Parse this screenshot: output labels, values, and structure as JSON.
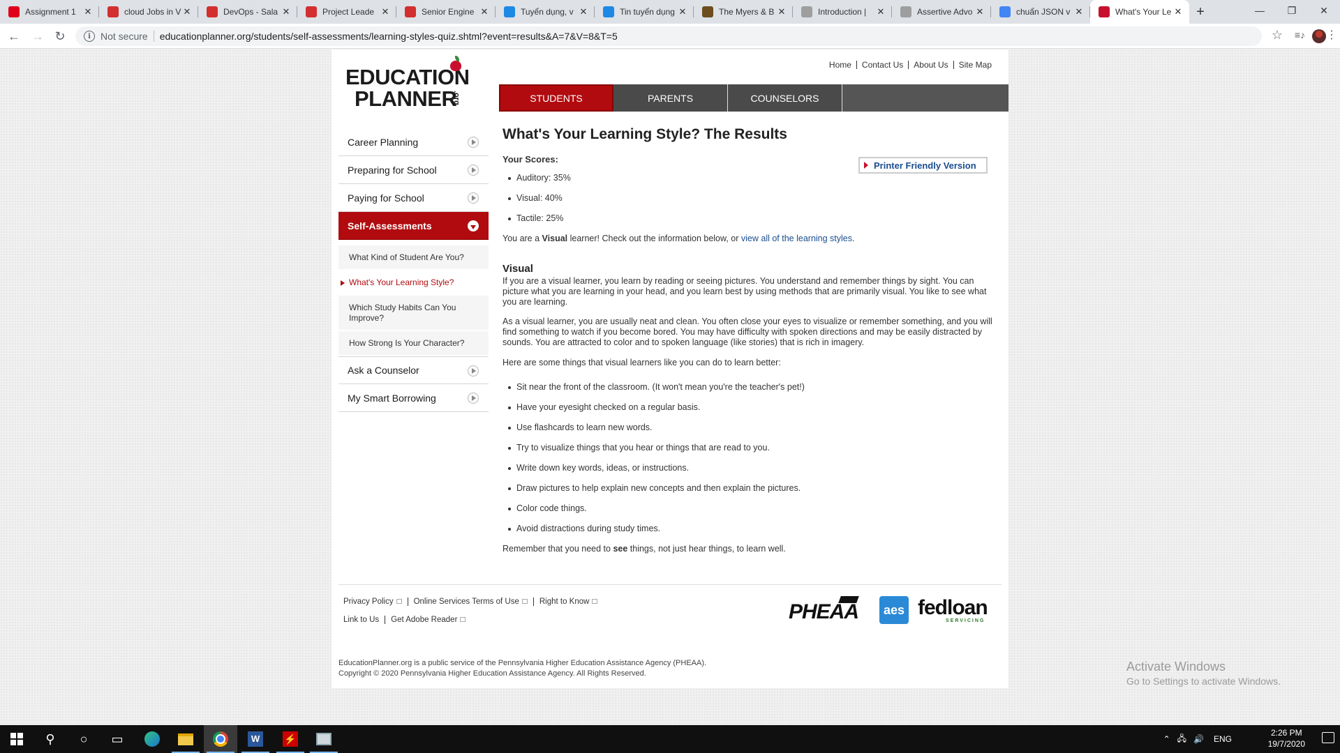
{
  "browser": {
    "tabs": [
      {
        "title": "Assignment 1",
        "favicon_color": "#e0001b"
      },
      {
        "title": "cloud Jobs in V",
        "favicon_color": "#d32f2f"
      },
      {
        "title": "DevOps - Sala",
        "favicon_color": "#d32f2f"
      },
      {
        "title": "Project Leade",
        "favicon_color": "#d32f2f"
      },
      {
        "title": "Senior Engine",
        "favicon_color": "#d32f2f"
      },
      {
        "title": "Tuyển dụng, v",
        "favicon_color": "#1e88e5"
      },
      {
        "title": "Tin tuyển dụng",
        "favicon_color": "#1e88e5"
      },
      {
        "title": "The Myers & B",
        "favicon_color": "#6d4c1f"
      },
      {
        "title": "Introduction |",
        "favicon_color": "#9e9e9e"
      },
      {
        "title": "Assertive Advo",
        "favicon_color": "#9e9e9e"
      },
      {
        "title": "chuẩn JSON v",
        "favicon_color": "#4285f4"
      },
      {
        "title": "What's Your Le",
        "favicon_color": "#c8102e"
      }
    ],
    "security_label": "Not secure",
    "url": "educationplanner.org/students/self-assessments/learning-styles-quiz.shtml?event=results&A=7&V=8&T=5"
  },
  "site": {
    "logo_line1": "EDUCATION",
    "logo_line2": "PLANNER",
    "logo_org": ".org",
    "top_links": [
      "Home",
      "Contact Us",
      "About Us",
      "Site Map"
    ],
    "main_nav": [
      "STUDENTS",
      "PARENTS",
      "COUNSELORS"
    ],
    "sidebar": {
      "items": [
        "Career Planning",
        "Preparing for School",
        "Paying for School",
        "Self-Assessments"
      ],
      "sub_items": [
        "What Kind of Student Are You?",
        "What's Your Learning Style?",
        "Which Study Habits Can You Improve?",
        "How Strong Is Your Character?"
      ],
      "items_after": [
        "Ask a Counselor",
        "My Smart Borrowing"
      ]
    }
  },
  "content": {
    "title": "What's Your Learning Style? The Results",
    "scores_label": "Your Scores:",
    "printer_label": "Printer Friendly Version",
    "scores": [
      "Auditory: 35%",
      "Visual: 40%",
      "Tactile: 25%"
    ],
    "you_are_prefix": "You are a ",
    "you_are_type": "Visual",
    "you_are_suffix": " learner! Check out the information below, or ",
    "you_are_link": "view all of the learning styles",
    "you_are_end": ".",
    "section_title": "Visual",
    "para1": "If you are a visual learner, you learn by reading or seeing pictures. You understand and remember things by sight. You can picture what you are learning in your head, and you learn best by using methods that are primarily visual. You like to see what you are learning.",
    "para2": "As a visual learner, you are usually neat and clean. You often close your eyes to visualize or remember something, and you will find something to watch if you become bored. You may have difficulty with spoken directions and may be easily distracted by sounds. You are attracted to color and to spoken language (like stories) that is rich in imagery.",
    "para3": "Here are some things that visual learners like you can do to learn better:",
    "tips": [
      "Sit near the front of the classroom. (It won't mean you're the teacher's pet!)",
      "Have your eyesight checked on a regular basis.",
      "Use flashcards to learn new words.",
      "Try to visualize things that you hear or things that are read to you.",
      "Write down key words, ideas, or instructions.",
      "Draw pictures to help explain new concepts and then explain the pictures.",
      "Color code things.",
      "Avoid distractions during study times."
    ],
    "remember_prefix": "Remember that you need to ",
    "remember_bold": "see",
    "remember_suffix": " things, not just hear things, to learn well."
  },
  "footer": {
    "links_row1": [
      "Privacy Policy",
      "Online Services Terms of Use",
      "Right to Know"
    ],
    "links_row2": [
      "Link to Us",
      "Get Adobe Reader"
    ],
    "logo_pheaa": "PHEAA",
    "logo_aes": "aes",
    "logo_fedloan": "fedloan",
    "logo_fedloan_sub": "SERVICING",
    "legal1": "EducationPlanner.org is a public service of the Pennsylvania Higher Education Assistance Agency (PHEAA).",
    "legal2": "Copyright © 2020 Pennsylvania Higher Education Assistance Agency. All Rights Reserved."
  },
  "watermark": {
    "line1": "Activate Windows",
    "line2": "Go to Settings to activate Windows."
  },
  "taskbar": {
    "lang": "ENG",
    "time": "2:26 PM",
    "date": "19/7/2020"
  },
  "colors": {
    "brand_red": "#b10b0f",
    "link_blue": "#1a4d8f"
  }
}
